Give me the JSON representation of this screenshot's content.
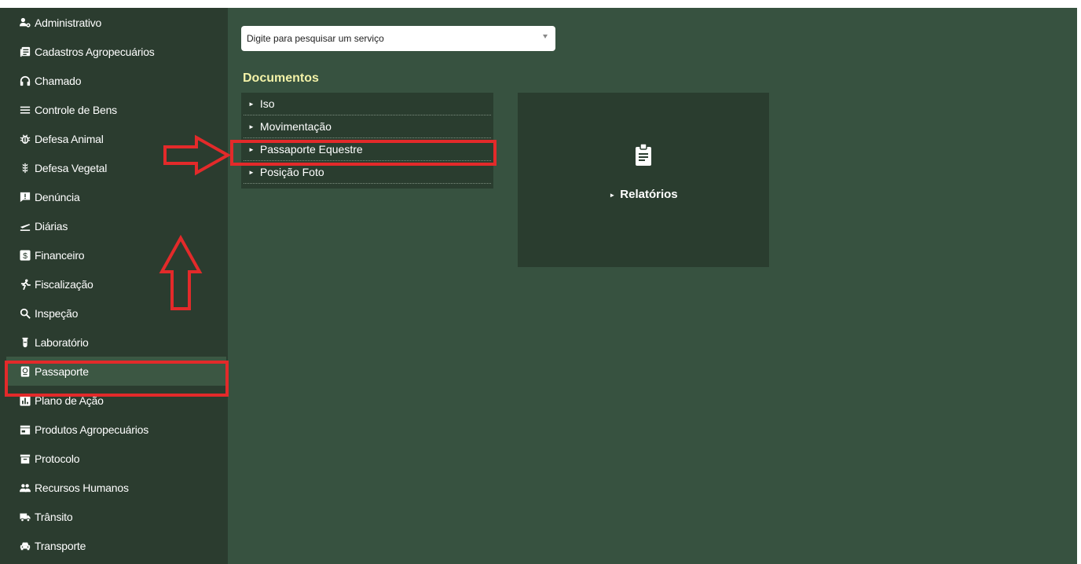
{
  "sidebar": {
    "items": [
      {
        "label": "Administrativo",
        "icon": "users-cog-icon"
      },
      {
        "label": "Cadastros Agropecuários",
        "icon": "list-card-icon"
      },
      {
        "label": "Chamado",
        "icon": "headset-icon"
      },
      {
        "label": "Controle de Bens",
        "icon": "list-icon"
      },
      {
        "label": "Defesa Animal",
        "icon": "bug-icon"
      },
      {
        "label": "Defesa Vegetal",
        "icon": "wheat-icon"
      },
      {
        "label": "Denúncia",
        "icon": "report-icon"
      },
      {
        "label": "Diárias",
        "icon": "plane-icon"
      },
      {
        "label": "Financeiro",
        "icon": "dollar-icon"
      },
      {
        "label": "Fiscalização",
        "icon": "inspector-icon"
      },
      {
        "label": "Inspeção",
        "icon": "search-icon"
      },
      {
        "label": "Laboratório",
        "icon": "test-tube-icon"
      },
      {
        "label": "Passaporte",
        "icon": "passport-icon",
        "active": true
      },
      {
        "label": "Plano de Ação",
        "icon": "chart-icon"
      },
      {
        "label": "Produtos Agropecuários",
        "icon": "store-icon"
      },
      {
        "label": "Protocolo",
        "icon": "archive-icon"
      },
      {
        "label": "Recursos Humanos",
        "icon": "group-icon"
      },
      {
        "label": "Trânsito",
        "icon": "truck-icon"
      },
      {
        "label": "Transporte",
        "icon": "car-icon"
      }
    ]
  },
  "search": {
    "placeholder": "Digite para pesquisar um serviço"
  },
  "documents": {
    "title": "Documentos",
    "items": [
      "Iso",
      "Movimentação",
      "Passaporte Equestre",
      "Posição Foto"
    ]
  },
  "card": {
    "label": "Relatórios",
    "icon": "clipboard-icon"
  },
  "colors": {
    "sidebar_bg": "#2b3c2f",
    "main_bg": "#375240",
    "panel_bg": "#2a3d2f",
    "title": "#f3f2a8",
    "highlight": "#e32a2a"
  }
}
